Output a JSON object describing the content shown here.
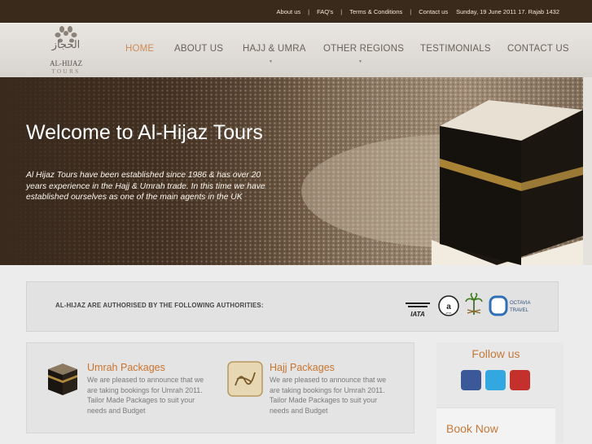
{
  "top_links": [
    "About us",
    "FAQ's",
    "Terms & Conditions",
    "Contact us"
  ],
  "date_text": "Sunday, 19 June 2011   17. Rajab 1432",
  "logo": {
    "name": "AL-HIJAZ",
    "tagline": "TOURS",
    "arabic": "الحجاز"
  },
  "nav": [
    {
      "label": "HOME",
      "active": true,
      "dropdown": false
    },
    {
      "label": "ABOUT US",
      "active": false,
      "dropdown": false
    },
    {
      "label": "HAJJ & UMRA",
      "active": false,
      "dropdown": true
    },
    {
      "label": "OTHER REGIONS",
      "active": false,
      "dropdown": true
    },
    {
      "label": "TESTIMONIALS",
      "active": false,
      "dropdown": false
    },
    {
      "label": "CONTACT US",
      "active": false,
      "dropdown": false
    }
  ],
  "hero": {
    "title": "Welcome to Al-Hijaz Tours",
    "text": "Al Hijaz Tours have been established since 1986 & has over 20 years experience in the Hajj & Umrah trade. In this time we have established ourselves as one of the main agents in the UK"
  },
  "authorities": {
    "label": "AL-HIJAZ ARE AUTHORISED BY THE FOLLOWING AUTHORITIES:",
    "logos": {
      "iata": "IATA",
      "atol": "ATOL",
      "octavia": "OCTAVIA",
      "travel": "TRAVEL"
    }
  },
  "packages": [
    {
      "title": "Umrah Packages",
      "text": "We are pleased to announce that we are taking bookings for Umrah 2011. Tailor Made Packages to suit your needs and Budget"
    },
    {
      "title": "Hajj Packages",
      "text": "We are pleased to announce that we are taking bookings for Umrah 2011. Tailor Made Packages to suit your needs and Budget"
    }
  ],
  "sidebar": {
    "follow": "Follow us",
    "book": "Book Now"
  },
  "colors": {
    "topbar": "#3a2a1c",
    "accent": "#c8742f",
    "facebook": "#3b5998",
    "twitter": "#33a8e0",
    "youtube": "#c4302b"
  }
}
